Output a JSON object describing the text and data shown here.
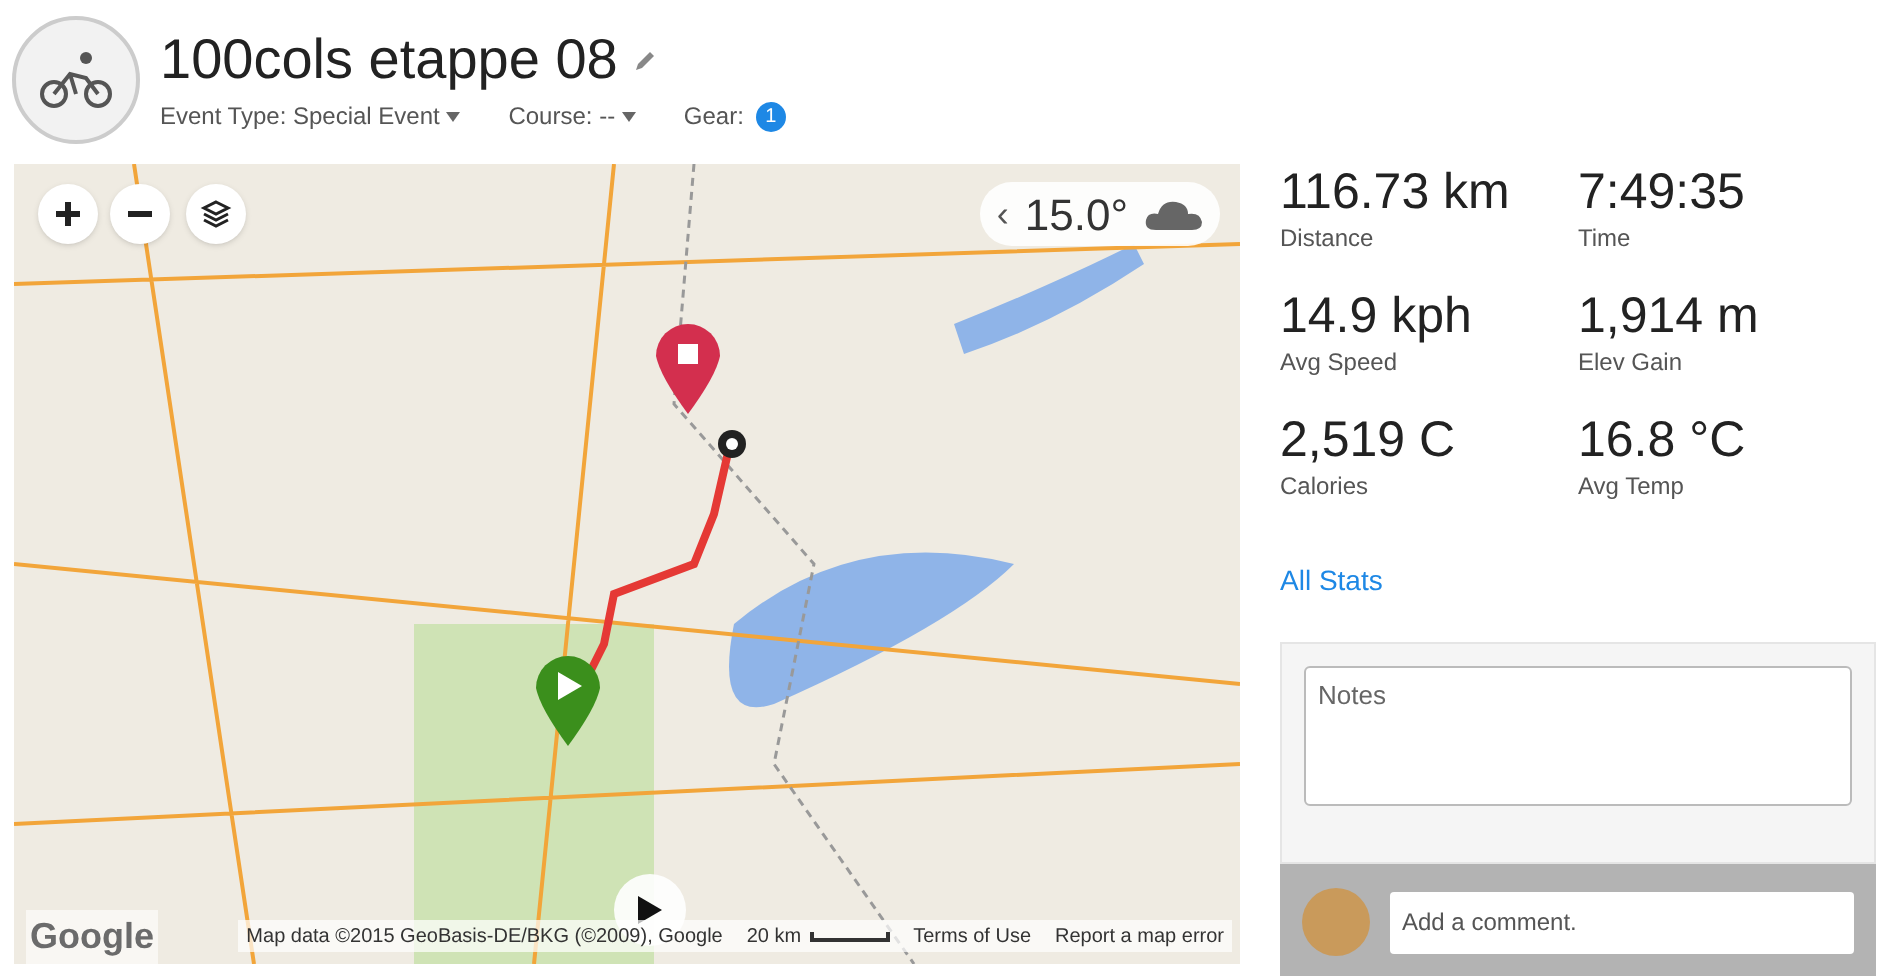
{
  "header": {
    "title": "100cols etappe 08",
    "event_type": "Event Type: Special Event",
    "course": "Course: --",
    "gear_label": "Gear:",
    "gear_count": "1"
  },
  "map": {
    "weather": {
      "chevron": "‹",
      "temperature": "15.0°"
    },
    "logo": "Google",
    "attribution": "Map data ©2015 GeoBasis-DE/BKG (©2009), Google",
    "scale": "20 km",
    "links": [
      "Terms of Use",
      "Report a map error"
    ]
  },
  "stats": [
    {
      "value": "116.73 km",
      "label": "Distance"
    },
    {
      "value": "7:49:35",
      "label": "Time"
    },
    {
      "value": "14.9 kph",
      "label": "Avg Speed"
    },
    {
      "value": "1,914 m",
      "label": "Elev Gain"
    },
    {
      "value": "2,519 C",
      "label": "Calories"
    },
    {
      "value": "16.8 °C",
      "label": "Avg Temp"
    }
  ],
  "all_stats_link": "All Stats",
  "notes": {
    "placeholder": "Notes"
  },
  "comment": {
    "placeholder": "Add a comment."
  }
}
